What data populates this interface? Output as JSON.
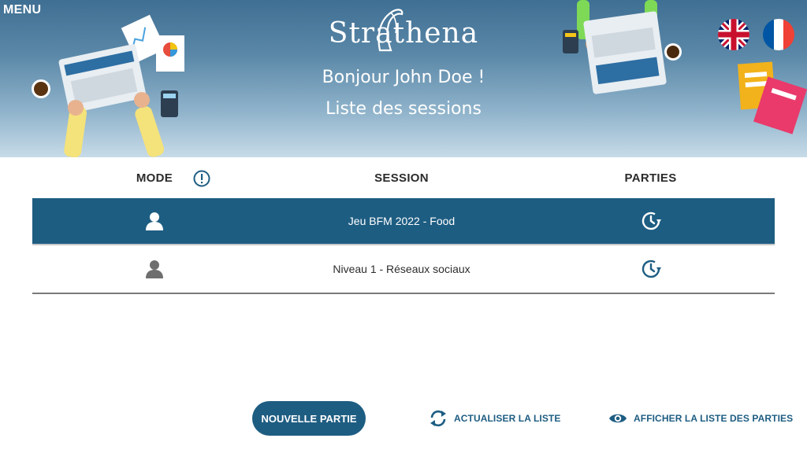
{
  "header": {
    "menu_label": "MENU",
    "logo_text": "Strathena",
    "greeting": "Bonjour John Doe !",
    "subtitle": "Liste des sessions",
    "languages": [
      "English",
      "Français"
    ]
  },
  "table": {
    "columns": [
      "MODE",
      "SESSION",
      "PARTIES"
    ],
    "rows": [
      {
        "mode_icon": "user-icon",
        "session": "Jeu BFM 2022 - Food",
        "parties_icon": "history-clock-icon",
        "selected": true
      },
      {
        "mode_icon": "user-icon",
        "session": "Niveau 1 - Réseaux sociaux",
        "parties_icon": "history-clock-icon",
        "selected": false
      }
    ]
  },
  "actions": {
    "new_game": "NOUVELLE PARTIE",
    "refresh": "ACTUALISER LA LISTE",
    "view_games": "AFFICHER LA LISTE DES PARTIES"
  },
  "colors": {
    "accent": "#1e5d82",
    "header_top": "#3f6f93",
    "header_bottom": "#c7dbe8"
  }
}
